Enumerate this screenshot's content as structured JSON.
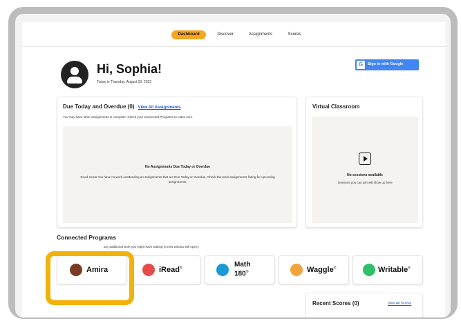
{
  "nav": {
    "tabs": [
      {
        "label": "Dashboard",
        "active": true
      },
      {
        "label": "Discover",
        "active": false
      },
      {
        "label": "Assignments",
        "active": false
      },
      {
        "label": "Scores",
        "active": false
      }
    ]
  },
  "header": {
    "greeting": "Hi, Sophia!",
    "date": "Today is Thursday, August 03, 2023",
    "google_button": "Sign in with Google",
    "google_letter": "G"
  },
  "due": {
    "title": "Due Today and Overdue (0)",
    "view_all": "View All Assignments",
    "subtitle": "You may have other assignments to complete. Check your Connected Programs to make sure.",
    "empty_title": "No Assignments Due Today or Overdue",
    "empty_body": "Good news! You have no work outstanding on assignments that are Due Today or Overdue. Check the main assignments listing for upcoming assignments."
  },
  "virtual_classroom": {
    "title": "Virtual Classroom",
    "empty_title": "No sessions available",
    "empty_body": "Sessions you can join will show up here"
  },
  "connected_programs": {
    "title": "Connected Programs",
    "subtitle": "any additional work you might have waiting (a new window will open).",
    "items": [
      {
        "name": "Amira",
        "icon": "amira-logo-icon",
        "color": "#c0392b"
      },
      {
        "name": "iRead",
        "icon": "iread-logo-icon",
        "color": "#e74c3c",
        "reg": "®"
      },
      {
        "name": "Math",
        "name2": "180",
        "icon": "math180-logo-icon",
        "color": "#1a9ad6",
        "reg": "®"
      },
      {
        "name": "Waggle",
        "icon": "waggle-logo-icon",
        "color": "#f39c12",
        "reg": "®"
      },
      {
        "name": "Writable",
        "icon": "writable-logo-icon",
        "color": "#27ae60",
        "reg": "®"
      }
    ]
  },
  "recent_scores": {
    "title": "Recent Scores (0)",
    "view_all": "View All Scores"
  },
  "colors": {
    "accent": "#f5a623",
    "highlight": "#f2b20c",
    "google_blue": "#4285f4",
    "link": "#1a56c4"
  }
}
